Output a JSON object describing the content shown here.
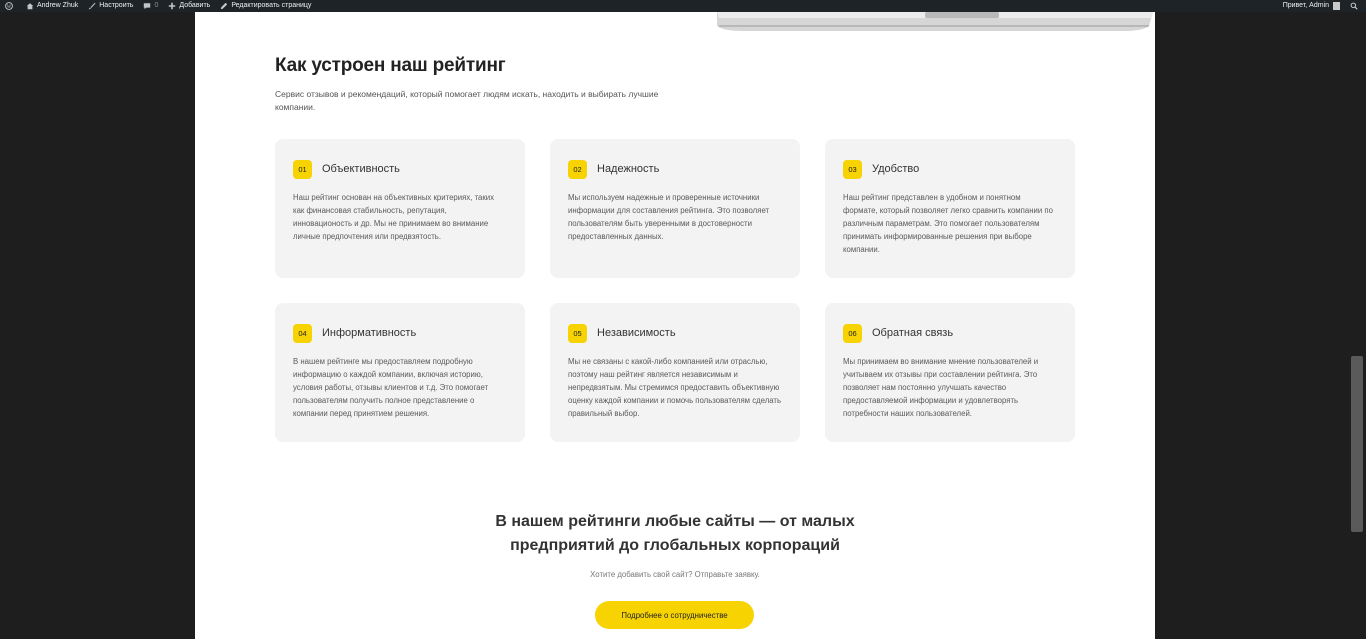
{
  "adminbar": {
    "items": [
      {
        "label": "Andrew Zhuk",
        "icon": "home-icon"
      },
      {
        "label": "Настроить",
        "icon": "brush-icon"
      },
      {
        "label": "0",
        "icon": "comment-icon"
      },
      {
        "label": "Добавить",
        "icon": "plus-icon"
      },
      {
        "label": "Редактировать страницу",
        "icon": "pencil-icon"
      }
    ],
    "greeting": "Привет, Admin"
  },
  "section": {
    "title": "Как устроен наш рейтинг",
    "subtitle": "Сервис отзывов и рекомендаций, который помогает людям искать, находить и выбирать лучшие компании."
  },
  "cards": [
    {
      "num": "01",
      "title": "Объективность",
      "text": "Наш рейтинг основан на объективных критериях, таких как финансовая стабильность, репутация, инновационость и др. Мы не принимаем во внимание личные предпочтения или предвзятость."
    },
    {
      "num": "02",
      "title": "Надежность",
      "text": "Мы используем надежные и проверенные источники информации для составления рейтинга. Это позволяет пользователям быть уверенными в достоверности предоставленных данных."
    },
    {
      "num": "03",
      "title": "Удобство",
      "text": "Наш рейтинг представлен в удобном и понятном формате, который позволяет легко сравнить компании по различным параметрам. Это помогает пользователям принимать информированные решения при выборе компании."
    },
    {
      "num": "04",
      "title": "Информативность",
      "text": "В нашем рейтинге мы предоставляем подробную информацию о каждой компании, включая историю, условия работы, отзывы клиентов и т.д. Это помогает пользователям получить полное представление о компании перед принятием решения."
    },
    {
      "num": "05",
      "title": "Независимость",
      "text": "Мы не связаны с какой-либо компанией или отраслью, поэтому наш рейтинг является независимым и непредвзятым. Мы стремимся предоставить объективную оценку каждой компании и помочь пользователям сделать правильный выбор."
    },
    {
      "num": "06",
      "title": "Обратная связь",
      "text": "Мы принимаем во внимание мнение пользователей и учитываем их отзывы при составлении рейтинга. Это позволяет нам постоянно улучшать качество предоставляемой информации и удовлетворять потребности наших пользователей."
    }
  ],
  "bottom": {
    "title_line1": "В нашем рейтинги любые сайты — от малых",
    "title_line2": "предприятий до глобальных корпораций",
    "subtitle": "Хотите добавить свой сайт? Отправьте заявку.",
    "cta_label": "Подробнее о сотрудничестве"
  },
  "colors": {
    "accent": "#f7d302",
    "card_bg": "#f3f3f3",
    "adminbar_bg": "#1d2327",
    "outer_bg": "#1e1e1e"
  }
}
